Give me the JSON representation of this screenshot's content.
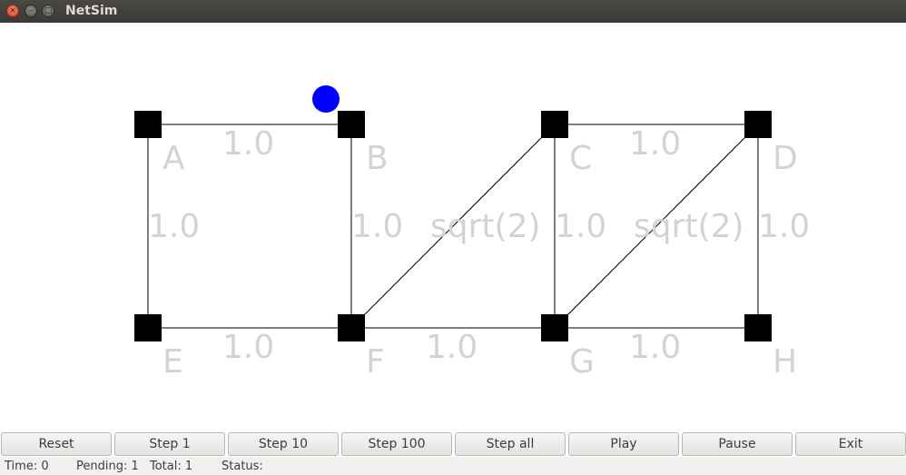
{
  "window": {
    "title": "NetSim",
    "controls": [
      "close",
      "minimize",
      "maximize"
    ]
  },
  "graph": {
    "nodes": [
      {
        "id": "A",
        "label": "A"
      },
      {
        "id": "B",
        "label": "B"
      },
      {
        "id": "C",
        "label": "C"
      },
      {
        "id": "D",
        "label": "D"
      },
      {
        "id": "E",
        "label": "E"
      },
      {
        "id": "F",
        "label": "F"
      },
      {
        "id": "G",
        "label": "G"
      },
      {
        "id": "H",
        "label": "H"
      }
    ],
    "edges": [
      {
        "from": "A",
        "to": "B",
        "weight": "1.0"
      },
      {
        "from": "A",
        "to": "E",
        "weight": "1.0"
      },
      {
        "from": "B",
        "to": "F",
        "weight": "1.0"
      },
      {
        "from": "E",
        "to": "F",
        "weight": "1.0"
      },
      {
        "from": "F",
        "to": "C",
        "weight": "sqrt(2)"
      },
      {
        "from": "C",
        "to": "D",
        "weight": "1.0"
      },
      {
        "from": "C",
        "to": "G",
        "weight": "1.0"
      },
      {
        "from": "F",
        "to": "G",
        "weight": "1.0"
      },
      {
        "from": "G",
        "to": "D",
        "weight": "sqrt(2)"
      },
      {
        "from": "D",
        "to": "H",
        "weight": "1.0"
      },
      {
        "from": "G",
        "to": "H",
        "weight": "1.0"
      }
    ],
    "packet": {
      "color": "#0000ff",
      "edge": "A-B"
    },
    "colors": {
      "node": "#000000",
      "edge": "#000000",
      "label": "#d3d3d3"
    }
  },
  "buttons": {
    "reset": "Reset",
    "step1": "Step 1",
    "step10": "Step 10",
    "step100": "Step 100",
    "stepall": "Step all",
    "play": "Play",
    "pause": "Pause",
    "exit": "Exit"
  },
  "status": {
    "time": "Time: 0",
    "pending": "Pending: 1",
    "total": "Total: 1",
    "status": "Status:"
  }
}
